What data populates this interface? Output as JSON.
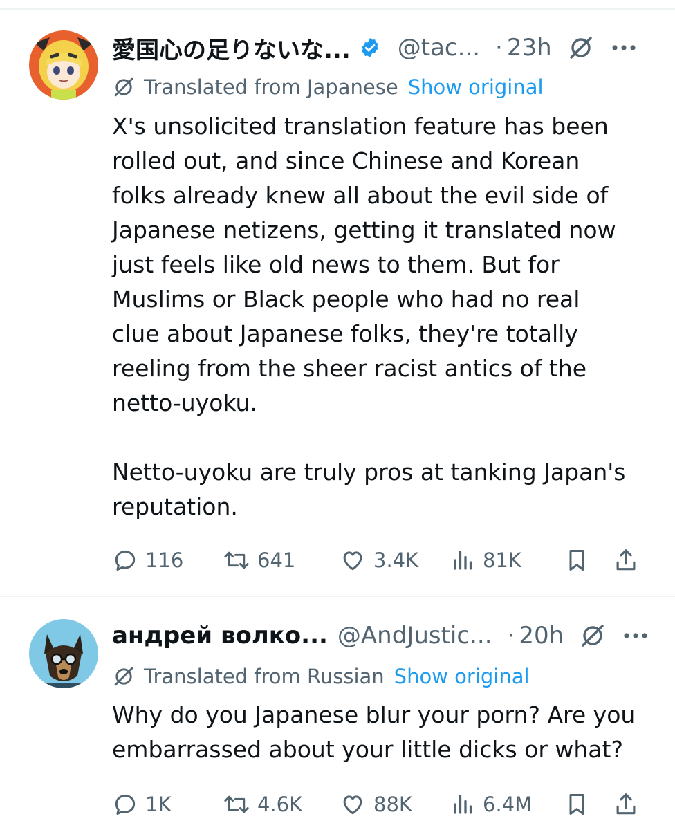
{
  "tweets": [
    {
      "display_name": "愛国心の足りないな...",
      "handle": "@tac...",
      "separator": "·",
      "time": "23h",
      "translated_from": "Translated from Japanese",
      "show_original": "Show original",
      "text": "X's unsolicited translation feature has been\nrolled out, and since Chinese and Korean\nfolks already knew all about the evil side of\nJapanese netizens, getting it translated now\njust feels like old news to them. But for\nMuslims or Black people who had no real\nclue about Japanese folks, they're totally\nreeling from the sheer racist antics of the\nnetto-uyoku.\n\nNetto-uyoku are truly pros at tanking Japan's\nreputation.",
      "replies": "116",
      "reposts": "641",
      "likes": "3.4K",
      "views": "81K",
      "verified": true
    },
    {
      "display_name": "андрей волко...",
      "handle": "@AndJustic...",
      "separator": "·",
      "time": "20h",
      "translated_from": "Translated from Russian",
      "show_original": "Show original",
      "text": "Why do you Japanese blur your porn? Are you\nembarrassed about your little dicks or what?",
      "replies": "1K",
      "reposts": "4.6K",
      "likes": "88K",
      "views": "6.4M",
      "verified": false
    }
  ],
  "colors": {
    "text_primary": "#0f1419",
    "text_secondary": "#536471",
    "link": "#1d9bf0",
    "verified": "#1d9bf0",
    "divider": "#eff3f4"
  },
  "icons": {
    "verified": "verified-badge-icon",
    "grok": "grok-icon",
    "more": "more-icon",
    "translate": "translate-icon",
    "reply": "reply-icon",
    "repost": "repost-icon",
    "like": "like-icon",
    "views": "views-icon",
    "bookmark": "bookmark-icon",
    "share": "share-icon"
  }
}
